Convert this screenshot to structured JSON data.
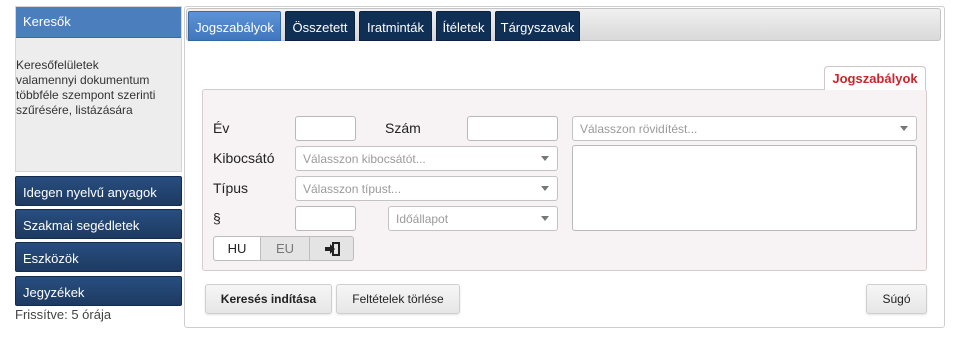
{
  "sidebar": {
    "header": "Keresők",
    "description": "Keresőfelületek valamennyi dokumentum többféle szempont szerinti szűrésére, listázására",
    "items": [
      {
        "label": "Idegen nyelvű anyagok"
      },
      {
        "label": "Szakmai segédletek"
      },
      {
        "label": "Eszközök"
      },
      {
        "label": "Jegyzékek"
      }
    ],
    "refreshed": "Frissítve: 5 órája"
  },
  "tabs": [
    {
      "label": "Jogszabályok",
      "active": true
    },
    {
      "label": "Összetett",
      "active": false
    },
    {
      "label": "Iratminták",
      "active": false
    },
    {
      "label": "Ítéletek",
      "active": false
    },
    {
      "label": "Tárgyszavak",
      "active": false
    }
  ],
  "form": {
    "section_label": "Jogszabályok",
    "year_label": "Év",
    "year_value": "",
    "number_label": "Szám",
    "number_value": "",
    "abbreviation_placeholder": "Válasszon rövidítést...",
    "issuer_label": "Kibocsátó",
    "issuer_placeholder": "Válasszon kibocsátót...",
    "type_label": "Típus",
    "type_placeholder": "Válasszon típust...",
    "section_sign_label": "§",
    "section_value": "",
    "time_state_placeholder": "Időállapot",
    "scope_options": [
      "HU",
      "EU"
    ],
    "selected_scope": "HU"
  },
  "actions": {
    "search_label": "Keresés indítása",
    "clear_label": "Feltételek törlése",
    "help_label": "Súgó"
  },
  "colors": {
    "active_tab": "#4a7ebd",
    "dark_nav": "#1d3a61",
    "section_accent": "#c8262a",
    "form_background": "#f7f2f3"
  },
  "icons": {
    "dropdown": "caret-down-icon",
    "scope_toggle": "login-arrow-icon"
  }
}
